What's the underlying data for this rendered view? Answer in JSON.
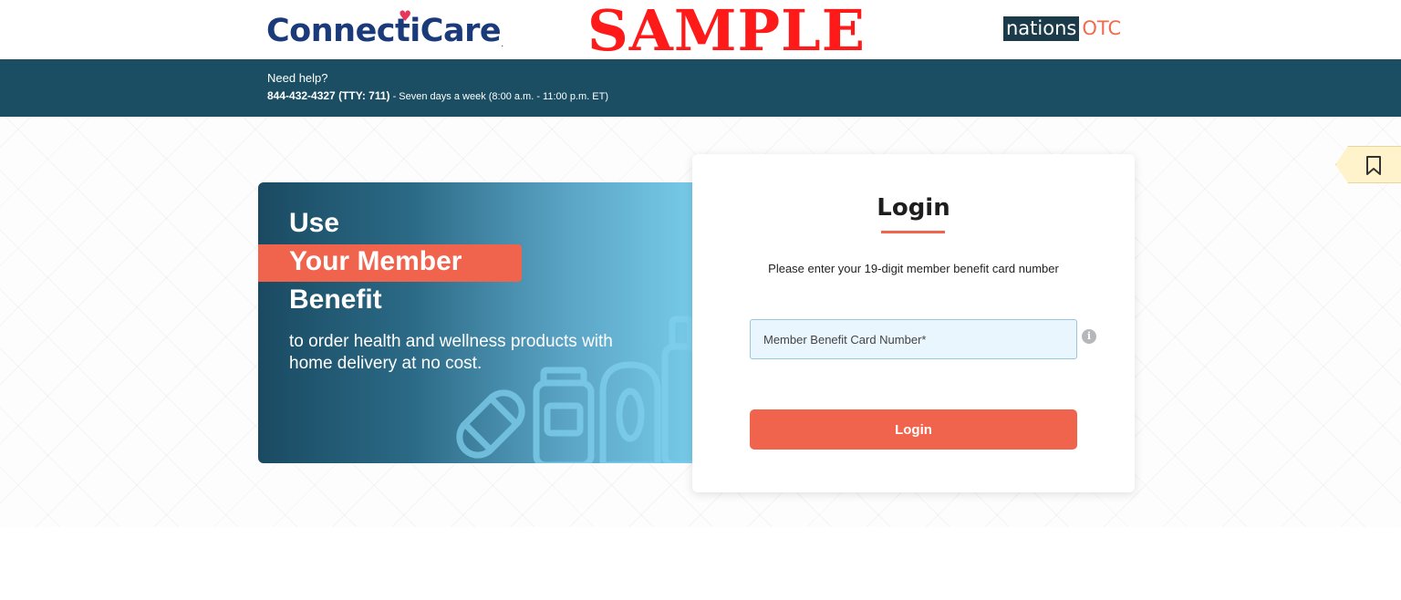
{
  "header": {
    "brand_left": "ConnectiCare",
    "brand_left_mark": ".",
    "watermark": "SAMPLE",
    "brand_right_part1": "nations",
    "brand_right_part2": "OTC"
  },
  "help_bar": {
    "label": "Need help?",
    "phone": "844-432-4327 (TTY: 711)",
    "hours": " - Seven days a week (8:00 a.m. - 11:00 p.m. ET)"
  },
  "hero": {
    "line1": "Use",
    "line2": "Your Member",
    "line3": "Benefit",
    "subtitle": "to order health and wellness products with home delivery at no cost."
  },
  "login": {
    "title": "Login",
    "instructions": "Please enter your 19-digit member benefit card number",
    "card_placeholder": "Member Benefit Card Number*",
    "card_value": "",
    "submit_label": "Login"
  },
  "colors": {
    "navy": "#1b4e63",
    "accent": "#f0644d",
    "watermark": "#ff1a1a"
  },
  "icons": {
    "info": "info-icon",
    "bookmark": "bookmark-icon",
    "heart": "heart-icon"
  }
}
